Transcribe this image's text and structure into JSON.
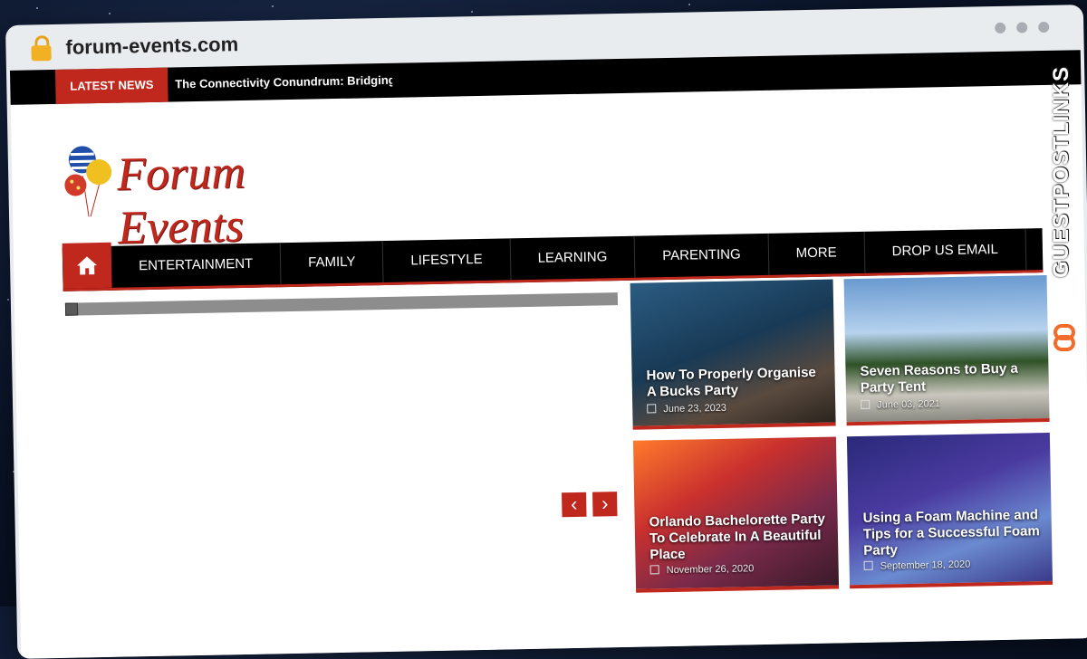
{
  "browser": {
    "url": "forum-events.com"
  },
  "ticker": {
    "label": "LATEST NEWS",
    "headline": "The Connectivity Conundrum: Bridging th"
  },
  "site": {
    "logo_text": "Forum Events"
  },
  "nav": {
    "home_icon": "home-icon",
    "items": [
      "ENTERTAINMENT",
      "FAMILY",
      "LIFESTYLE",
      "LEARNING",
      "PARENTING",
      "MORE",
      "DROP US EMAIL"
    ]
  },
  "slider": {
    "prev_icon": "chevron-left-icon",
    "next_icon": "chevron-right-icon",
    "prev": "‹",
    "next": "›"
  },
  "posts": [
    {
      "title": "How To Properly Organise A Bucks Party",
      "date": "June 23, 2023"
    },
    {
      "title": "Seven Reasons to Buy a Party Tent",
      "date": "June 03, 2021"
    },
    {
      "title": "Orlando Bachelorette Party To Celebrate In A Beautiful Place",
      "date": "November 26, 2020"
    },
    {
      "title": "Using a Foam Machine and Tips for a Successful Foam Party",
      "date": "September 18, 2020"
    }
  ],
  "watermark": {
    "text": "GUESTPOSTLINKS"
  },
  "colors": {
    "accent": "#c0281d",
    "nav_bg": "#000000",
    "frame": "#e9ecef"
  }
}
